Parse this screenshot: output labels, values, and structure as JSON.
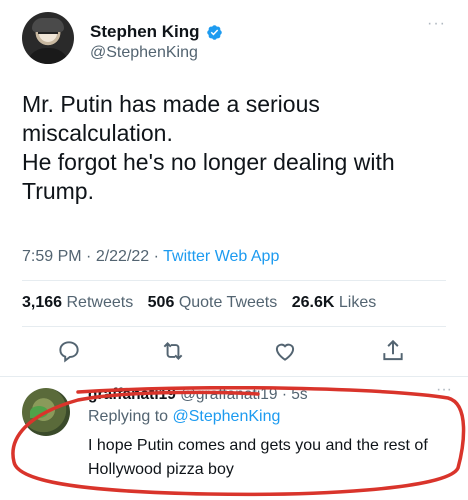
{
  "tweet": {
    "author": {
      "display_name": "Stephen King",
      "handle": "@StephenKing",
      "verified_icon": "verified-badge-icon",
      "avatar": "avatar"
    },
    "more_icon": "more-options-icon",
    "text_lines": [
      "Mr. Putin has made a serious",
      "miscalculation.",
      "He forgot he's no longer dealing with",
      "Trump."
    ],
    "meta": {
      "time": "7:59 PM",
      "separator": " · ",
      "date": "2/22/22",
      "app": "Twitter Web App"
    },
    "stats": {
      "retweets_count": "3,166",
      "retweets_label": "Retweets",
      "quotes_count": "506",
      "quotes_label": "Quote Tweets",
      "likes_count": "26.6K",
      "likes_label": "Likes"
    },
    "actions": [
      "reply-icon",
      "retweet-icon",
      "like-icon",
      "share-icon"
    ]
  },
  "reply": {
    "display_name": "graffanati19",
    "handle": "@graffanati19",
    "time": "· 5s",
    "replying_label": "Replying to",
    "replying_to": "@StephenKing",
    "text": "I hope Putin comes and gets you and the rest of Hollywood pizza boy"
  },
  "colors": {
    "accent": "#1d9bf0",
    "secondary_text": "#536471",
    "annotation_red": "#d9342b"
  }
}
